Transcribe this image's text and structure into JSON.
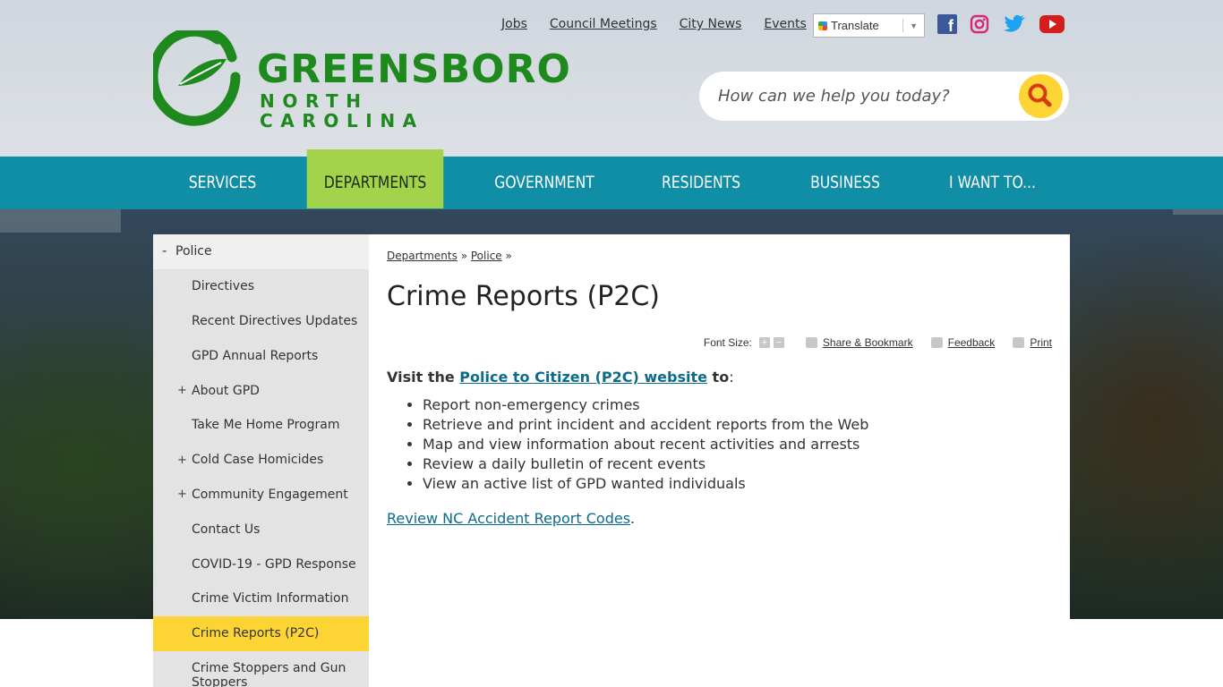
{
  "logo": {
    "word": "GREENSBORO",
    "sub": "NORTH CAROLINA"
  },
  "toplinks": [
    "Jobs",
    "Council Meetings",
    "City News",
    "Events"
  ],
  "translate": {
    "label": "Translate"
  },
  "social": {
    "facebook": "f"
  },
  "search": {
    "placeholder": "How can we help you today?"
  },
  "nav": [
    "SERVICES",
    "DEPARTMENTS",
    "GOVERNMENT",
    "RESIDENTS",
    "BUSINESS",
    "I WANT TO..."
  ],
  "sidebar": {
    "top": "Police",
    "top_marker": "-",
    "expand_marker": "+",
    "items": [
      {
        "label": "Directives"
      },
      {
        "label": "Recent Directives Updates"
      },
      {
        "label": "GPD Annual Reports"
      },
      {
        "label": "About GPD"
      },
      {
        "label": "Take Me Home Program"
      },
      {
        "label": "Cold Case Homicides"
      },
      {
        "label": "Community Engagement"
      },
      {
        "label": "Contact Us"
      },
      {
        "label": "COVID-19 - GPD Response"
      },
      {
        "label": "Crime Victim Information"
      },
      {
        "label": "Crime Reports (P2C)"
      },
      {
        "label": "Crime Stoppers and Gun Stoppers"
      }
    ]
  },
  "breadcrumb": {
    "item1": "Departments",
    "item2": "Police",
    "sep": "»"
  },
  "page_title": "Crime Reports (P2C)",
  "tools": {
    "font_size": "Font Size:",
    "plus": "+",
    "minus": "−",
    "share": "Share & Bookmark",
    "feedback": "Feedback",
    "print": "Print"
  },
  "content": {
    "intro_prefix": "Visit the ",
    "intro_link": "Police to Citizen (P2C) website",
    "intro_suffix": " to",
    "intro_colon": ":",
    "bullets": [
      "Report non-emergency crimes",
      "Retrieve and print incident and accident reports from the Web",
      "Map and view information about recent activities and arrests",
      "Review a daily bulletin of recent events",
      "View an active list of GPD wanted individuals"
    ],
    "review_link": "Review NC Accident Report Codes",
    "review_suffix": "."
  },
  "colors": {
    "nav": "#0f8ea6",
    "nav_active": "#a3d34b",
    "sidebar_active": "#fcd535",
    "brand_green": "#1e8a1e",
    "link": "#0b6b8a"
  }
}
